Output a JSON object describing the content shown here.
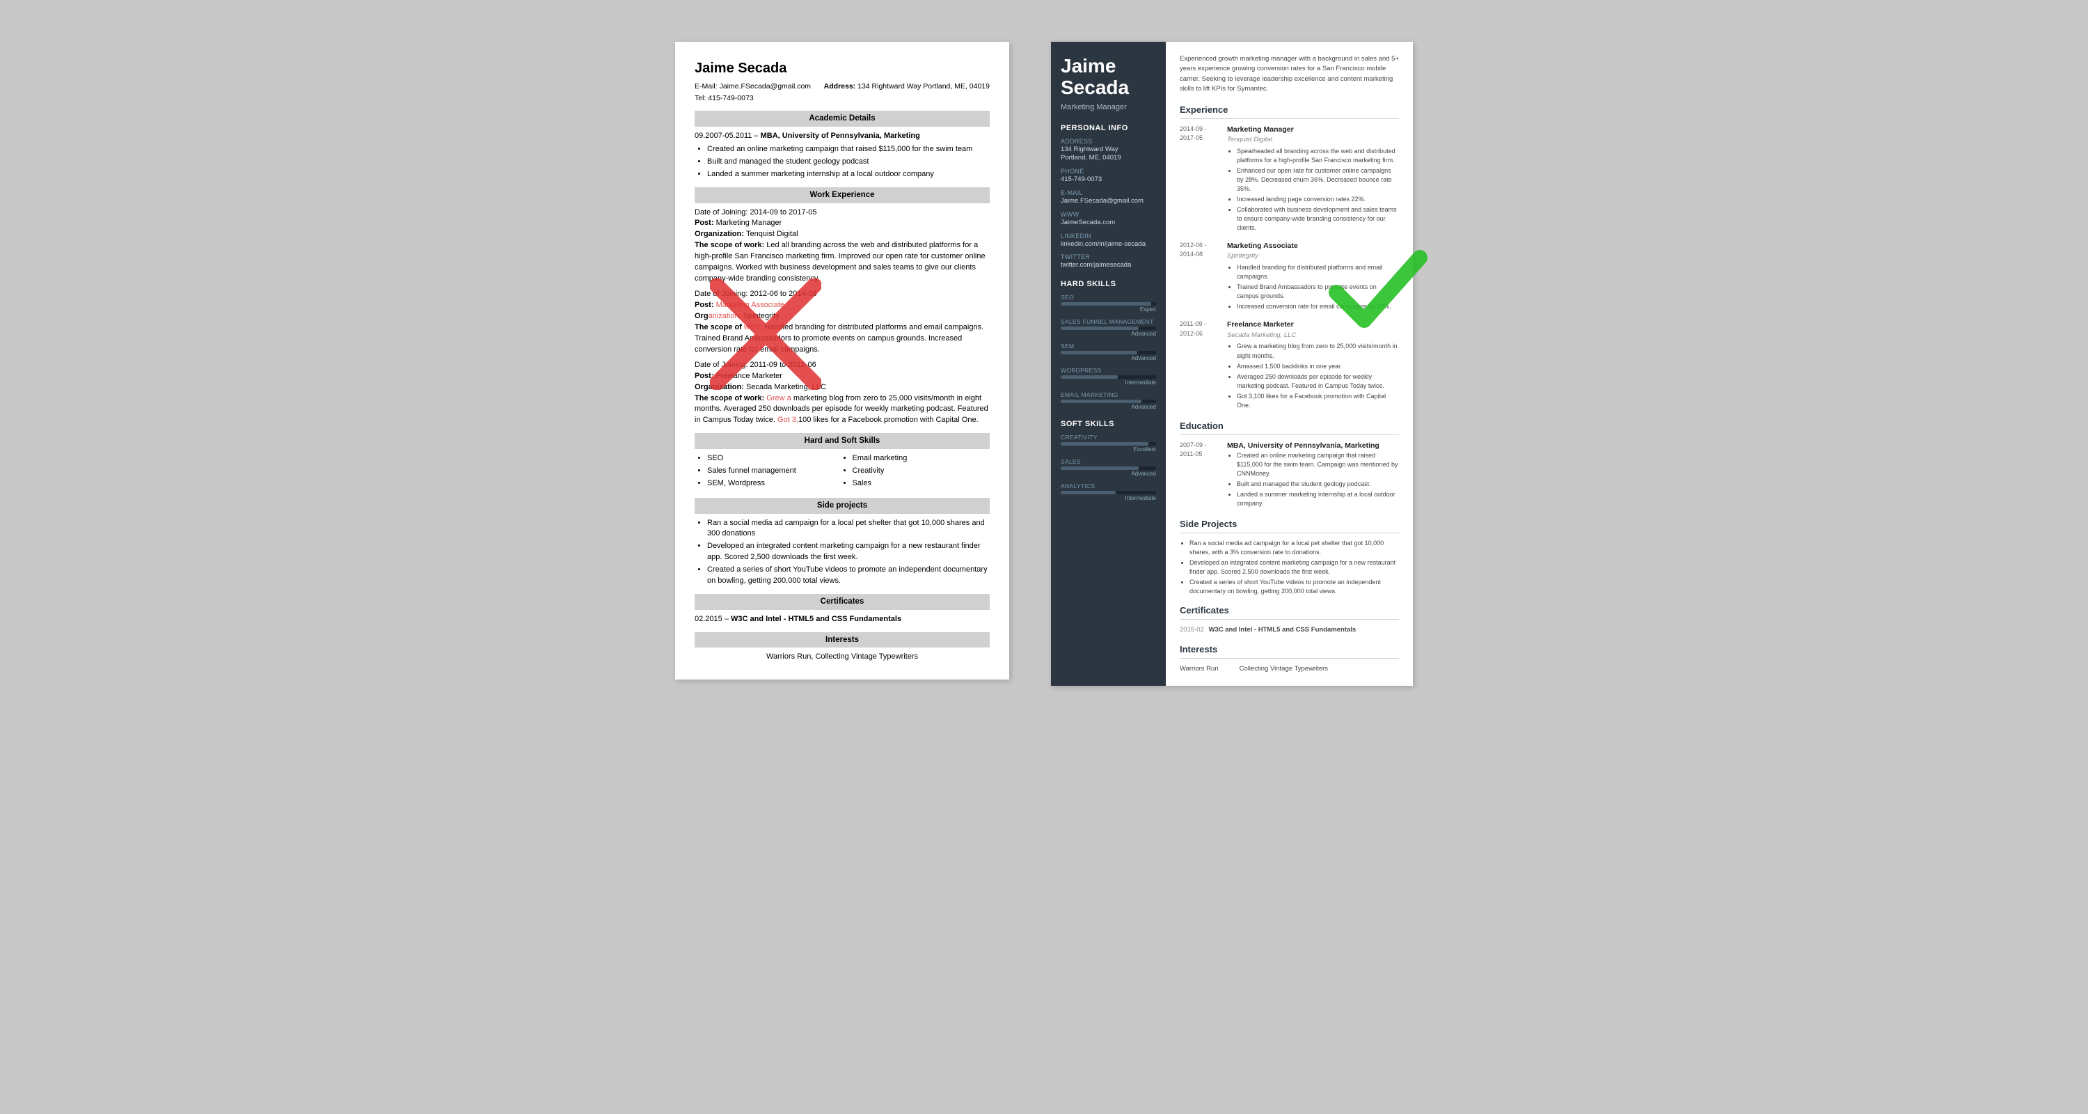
{
  "classic": {
    "name": "Jaime Secada",
    "email_label": "E-Mail:",
    "email": "Jaime.FSecada@gmail.com",
    "address_label": "Address:",
    "address": "134 Rightward Way Portland, ME, 04019",
    "tel_label": "Tel:",
    "tel": "415-749-0073",
    "sections": {
      "academic": "Academic Details",
      "work": "Work Experience",
      "skills": "Hard and Soft Skills",
      "side": "Side projects",
      "certs": "Certificates",
      "interests": "Interests"
    },
    "academic": [
      {
        "dates": "09.2007-05.2011",
        "degree": "MBA, University of Pennsylvania, Marketing",
        "bullets": [
          "Created an online marketing campaign that raised $115,000 for the swim team",
          "Built and managed the student geology podcast",
          "Landed a summer marketing internship at a local outdoor company"
        ]
      }
    ],
    "work": [
      {
        "joining": "Date of Joining: 2014-09 to 2017-05",
        "post": "Post: Marketing Manager",
        "org": "Organization: Tenquist Digital",
        "scope_label": "The scope of work:",
        "scope": "Led all branding across the web and distributed platforms for a high-profile San Francisco marketing firm. Improved our open rate for customer online campaigns. Worked with business development and sales teams to give our clients company-wide branding consistency."
      },
      {
        "joining": "Date of Joining: 2012-06 to 2014-08",
        "post": "Post: Marketing Associate",
        "org": "Organization: Spintegrity",
        "scope_label": "The scope of work:",
        "scope": "Handled branding for distributed platforms and email campaigns. Trained Brand Ambassadors to promote events on campus grounds. Increased conversion rate for email campaigns."
      },
      {
        "joining": "Date of Joining: 2011-09 to 2012-06",
        "post": "Post: Freelance Marketer",
        "org": "Organization: Secada Marketing, LLC",
        "scope_label": "The scope of work:",
        "scope": "Grew a marketing blog from zero to 25,000 visits/month in eight months. Averaged 250 downloads per episode for weekly marketing podcast. Featured in Campus Today twice. Got 3,100 likes for a Facebook promotion with Capital One."
      }
    ],
    "skills_list": [
      "SEO",
      "Sales funnel management",
      "SEM, Wordpress",
      "Email marketing",
      "Creativity",
      "Sales"
    ],
    "side_projects": [
      "Ran a social media ad campaign for a local pet shelter that got 10,000 shares and 300 donations",
      "Developed an integrated content marketing campaign for a new restaurant finder app. Scored 2,500 downloads the first week.",
      "Created a series of short YouTube videos to promote an independent documentary on bowling, getting 200,000 total views."
    ],
    "certificates": [
      {
        "date": "02.2015",
        "text": "W3C and Intel - HTML5 and CSS Fundamentals"
      }
    ],
    "interests": "Warriors Run, Collecting Vintage Typewriters"
  },
  "modern": {
    "first_name": "Jaime",
    "last_name": "Secada",
    "title": "Marketing Manager",
    "summary": "Experienced growth marketing manager with a background in sales and 5+ years experience growing conversion rates for a San Francisco mobile carrier. Seeking to leverage leadership excellence and content marketing skills to lift KPIs for Symantec.",
    "sidebar_sections": {
      "personal_info": "Personal Info",
      "hard_skills": "Hard Skills",
      "soft_skills": "Soft Skills"
    },
    "personal": {
      "address_label": "Address",
      "address": "134 Rightward Way\nPortland, ME, 04019",
      "phone_label": "Phone",
      "phone": "415-749-0073",
      "email_label": "E-mail",
      "email": "Jaime.FSecada@gmail.com",
      "www_label": "WWW",
      "www": "JaimeSecada.com",
      "linkedin_label": "LinkedIn",
      "linkedin": "linkedin.com/in/jaime-secada",
      "twitter_label": "Twitter",
      "twitter": "twitter.com/jaimesecada"
    },
    "hard_skills": [
      {
        "label": "SEO",
        "level": "Expert",
        "pct": 95
      },
      {
        "label": "SALES FUNNEL MANAGEMENT",
        "level": "Advanced",
        "pct": 82
      },
      {
        "label": "SEM",
        "level": "Advanced",
        "pct": 80
      },
      {
        "label": "WORDPRESS",
        "level": "Intermediate",
        "pct": 60
      },
      {
        "label": "EMAIL MARKETING",
        "level": "Advanced",
        "pct": 85
      }
    ],
    "soft_skills": [
      {
        "label": "CREATIVITY",
        "level": "Excellent",
        "pct": 92
      },
      {
        "label": "SALES",
        "level": "Advanced",
        "pct": 82
      },
      {
        "label": "ANALYTICS",
        "level": "Intermediate",
        "pct": 58
      }
    ],
    "main_sections": {
      "experience": "Experience",
      "education": "Education",
      "side_projects": "Side Projects",
      "certificates": "Certificates",
      "interests": "Interests"
    },
    "experience": [
      {
        "dates": "2014-09 -\n2017-05",
        "title": "Marketing Manager",
        "org": "Tenquist Digital",
        "bullets": [
          "Spearheaded all branding across the web and distributed platforms for a high-profile San Francisco marketing firm.",
          "Enhanced our open rate for customer online campaigns by 28%. Decreased churn 36%. Decreased bounce rate 35%.",
          "Increased landing page conversion rates 22%.",
          "Collaborated with business development and sales teams to ensure company-wide branding consistency for our clients."
        ]
      },
      {
        "dates": "2012-06 -\n2014-08",
        "title": "Marketing Associate",
        "org": "Spintegrity",
        "bullets": [
          "Handled branding for distributed platforms and email campaigns.",
          "Trained Brand Ambassadors to promote events on campus grounds.",
          "Increased conversion rate for email campaigns by 33%."
        ]
      },
      {
        "dates": "2011-09 -\n2012-06",
        "title": "Freelance Marketer",
        "org": "Secada Marketing, LLC",
        "bullets": [
          "Grew a marketing blog from zero to 25,000 visits/month in eight months.",
          "Amassed 1,500 backlinks in one year.",
          "Averaged 250 downloads per episode for weekly marketing podcast. Featured in Campus Today twice.",
          "Got 3,100 likes for a Facebook promotion with Capital One."
        ]
      }
    ],
    "education": [
      {
        "dates": "2007-09 -\n2011-05",
        "degree": "MBA, University of Pennsylvania, Marketing",
        "bullets": [
          "Created an online marketing campaign that raised $115,000 for the swim team. Campaign was mentioned by CNNMoney.",
          "Built and managed the student geology podcast.",
          "Landed a summer marketing internship at a local outdoor company."
        ]
      }
    ],
    "side_projects": [
      "Ran a social media ad campaign for a local pet shelter that got 10,000 shares, with a 3% conversion rate to donations.",
      "Developed an integrated content marketing campaign for a new restaurant finder app. Scored 2,500 downloads the first week.",
      "Created a series of short YouTube videos to promote an independent documentary on bowling, getting 200,000 total views."
    ],
    "certificates": [
      {
        "date": "2015-02",
        "text": "W3C and Intel - HTML5 and CSS Fundamentals"
      }
    ],
    "interests": [
      "Warriors Run",
      "Collecting Vintage Typewriters"
    ]
  }
}
